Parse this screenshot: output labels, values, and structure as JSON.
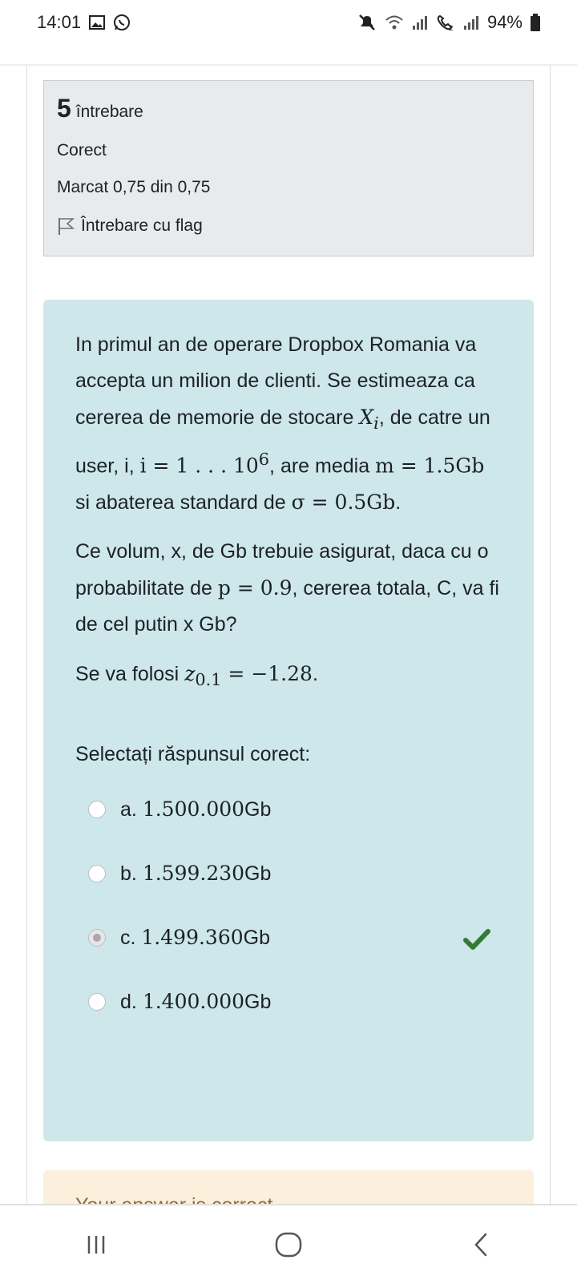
{
  "status_bar": {
    "time": "14:01",
    "battery": "94%",
    "icons": [
      "gallery-icon",
      "whatsapp-icon",
      "mute-icon",
      "wifi-icon",
      "signal-icon",
      "call-sim2-icon",
      "battery-icon"
    ]
  },
  "question_info": {
    "number": "5",
    "label": "întrebare",
    "state": "Corect",
    "grade": "Marcat 0,75 din 0,75",
    "flag_label": "Întrebare cu flag"
  },
  "question": {
    "p1_a": "In primul an de  operare Dropbox Romania va accepta un milion de clienti. Se estimeaza ca cererea de memorie de stocare ",
    "p1_var": "X",
    "p1_sub": "i",
    "p1_b": ", de catre un user, i, ",
    "p1_eq1": "i = 1 . . . 10",
    "p1_exp": "6",
    "p1_c": ", are media ",
    "p1_eq2": "m = 1.5Gb",
    "p1_d": " si  abaterea standard de ",
    "p1_eq3": "σ = 0.5Gb",
    "p1_e": ".",
    "p2_a": "Ce volum, x, de Gb trebuie asigurat, daca cu o probabilitate de ",
    "p2_eq": "p = 0.9",
    "p2_b": ", cererea totala, C, va fi de cel putin x Gb?",
    "p3_a": "Se va folosi ",
    "p3_z": "z",
    "p3_sub": "0.1",
    "p3_eq": " = −1.28",
    "p3_b": "."
  },
  "prompt": "Selectați răspunsul corect:",
  "answers": [
    {
      "letter": "a.",
      "value": "1.500.000",
      "unit": "Gb",
      "selected": false,
      "correct": false
    },
    {
      "letter": "b.",
      "value": "1.599.230",
      "unit": "Gb",
      "selected": false,
      "correct": false
    },
    {
      "letter": "c.",
      "value": "1.499.360",
      "unit": "Gb",
      "selected": true,
      "correct": true
    },
    {
      "letter": "d.",
      "value": "1.400.000",
      "unit": "Gb",
      "selected": false,
      "correct": false
    }
  ],
  "feedback": "Your answer is correct.",
  "colors": {
    "info_bg": "#e8eaec",
    "question_bg": "#cde7ea",
    "feedback_bg": "#fcefdc",
    "check_green": "#357a32"
  }
}
